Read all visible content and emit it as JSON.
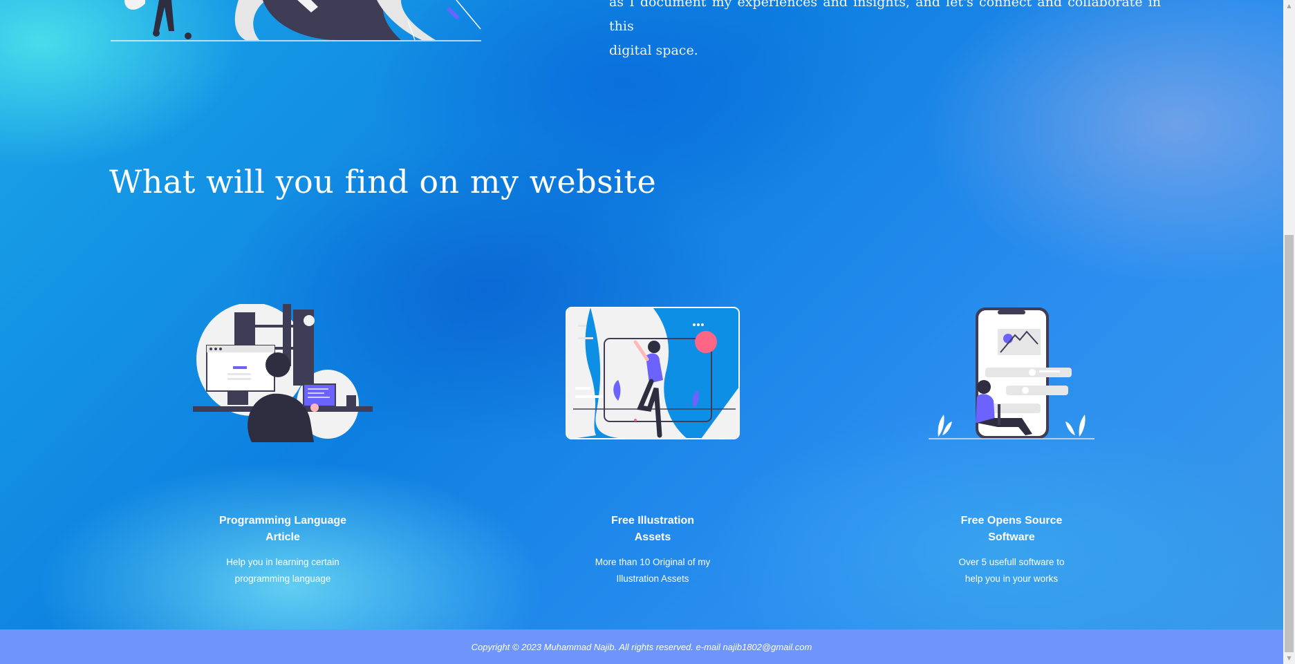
{
  "intro": {
    "line1": "as I document my experiences and insights, and let's connect and collaborate in this",
    "line2": "digital space."
  },
  "section": {
    "title": "What will you find on my website"
  },
  "cards": [
    {
      "icon": "programmer-desk-illustration",
      "title_line1": "Programming Language",
      "title_line2": "Article",
      "desc_line1": "Help you in learning certain",
      "desc_line2": "programming language"
    },
    {
      "icon": "illustration-canvas-illustration",
      "title_line1": "Free Illustration",
      "title_line2": "Assets",
      "desc_line1": "More than 10 Original of my",
      "desc_line2": "Illustration Assets"
    },
    {
      "icon": "mobile-app-illustration",
      "title_line1": "Free Opens Source",
      "title_line2": "Software",
      "desc_line1": "Over 5 usefull software to",
      "desc_line2": "help you in your works"
    }
  ],
  "footer": {
    "text": "Copyright © 2023 Muhammad Najib. All rights reserved. e-mail najib1802@gmail.com"
  },
  "colors": {
    "footer_bg": "#6d95fb",
    "accent_purple": "#6c63ff",
    "accent_pink": "#ff6584",
    "dark": "#3f3d56"
  }
}
